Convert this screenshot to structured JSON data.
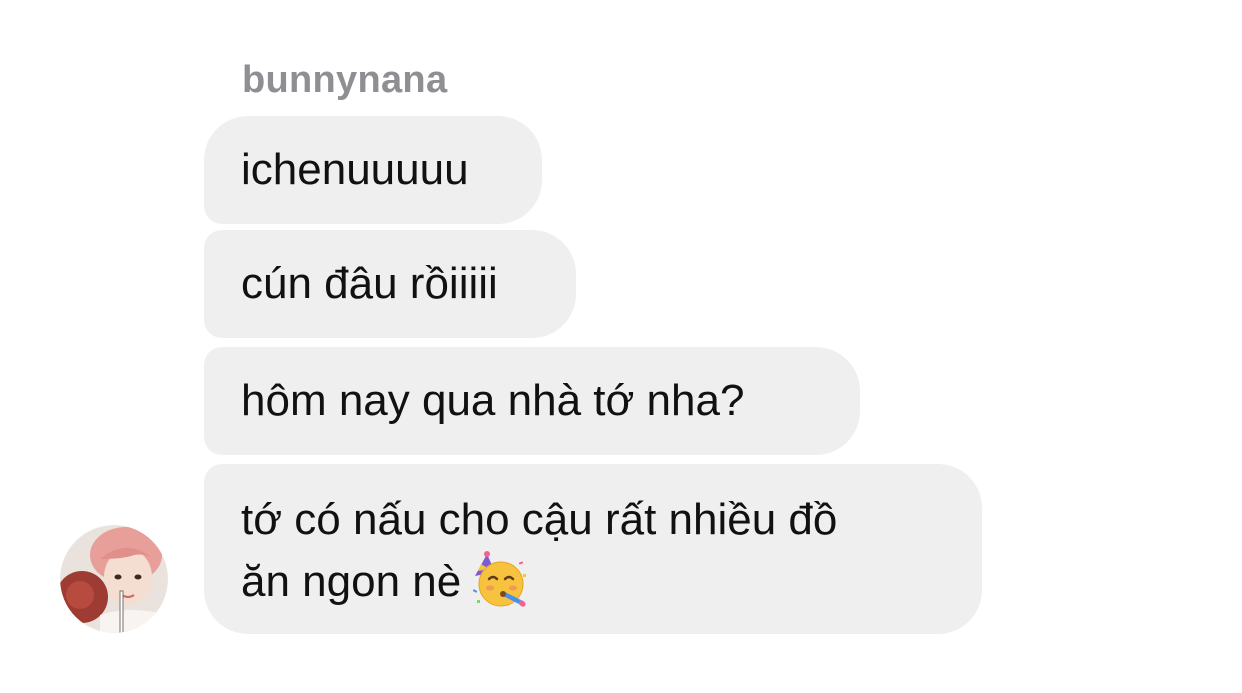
{
  "thread": {
    "sender_name": "bunnynana",
    "messages": [
      {
        "text": "ichenuuuuu"
      },
      {
        "text": "cún đâu rồiiiii"
      },
      {
        "text": "hôm nay qua nhà tớ nha?"
      },
      {
        "line1": "tớ có nấu cho cậu rất nhiều đồ",
        "line2": "ăn ngon nè",
        "emoji": "partying-face-emoji"
      }
    ],
    "avatar_icon": "profile-photo-avatar"
  },
  "colors": {
    "bubble_bg": "#efefef",
    "sender_name": "#8e8e93",
    "text": "#111111",
    "background": "#ffffff"
  }
}
